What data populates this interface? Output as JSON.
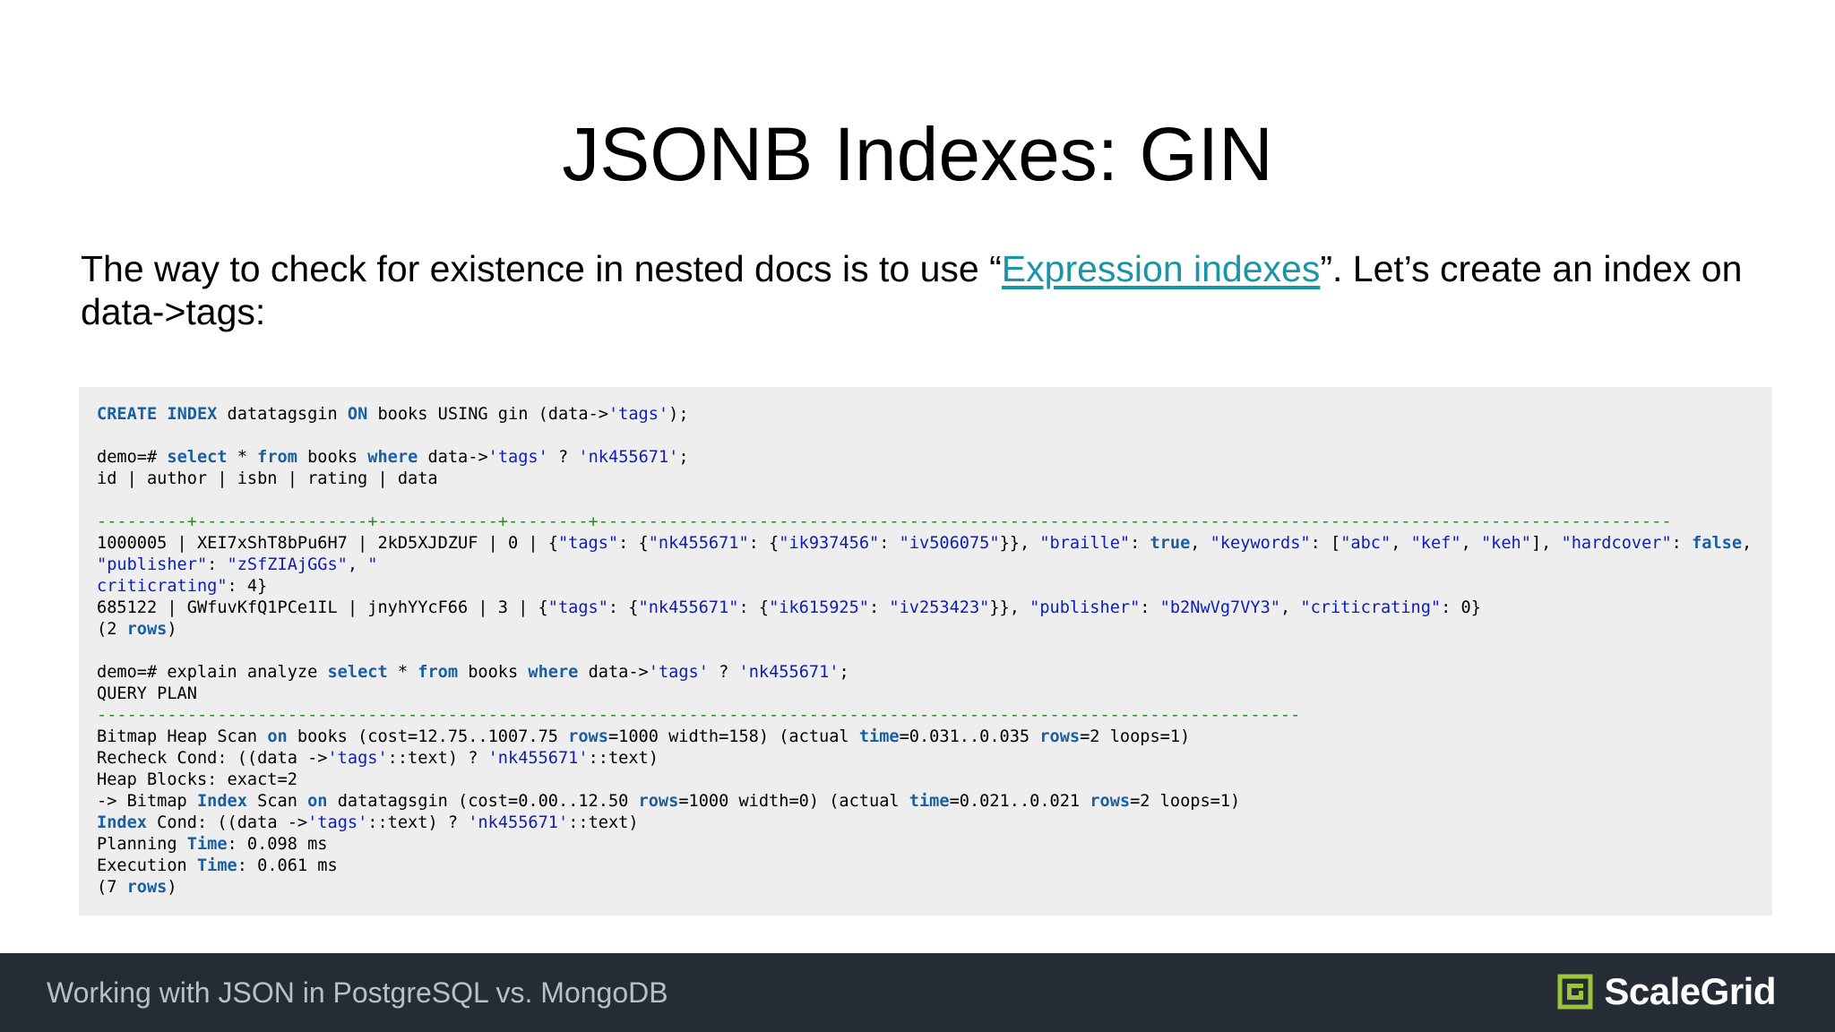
{
  "slide": {
    "title": "JSONB Indexes: GIN",
    "intro_before": "The way to check for existence in nested docs is to use “",
    "intro_link": "Expression indexes",
    "intro_after": "”. Let’s create an index on data->tags:"
  },
  "code": {
    "lines": [
      [
        [
          "CREATE",
          "kw"
        ],
        [
          " ",
          ""
        ],
        [
          "INDEX",
          "kw"
        ],
        [
          " datatagsgin ",
          ""
        ],
        [
          "ON",
          "kw"
        ],
        [
          " books USING gin (data->",
          ""
        ],
        [
          "'tags'",
          "str"
        ],
        [
          ");",
          ""
        ]
      ],
      [],
      [
        [
          "demo=# ",
          ""
        ],
        [
          "select",
          "kw"
        ],
        [
          " * ",
          ""
        ],
        [
          "from",
          "kw"
        ],
        [
          " books ",
          ""
        ],
        [
          "where",
          "kw"
        ],
        [
          " data->",
          ""
        ],
        [
          "'tags'",
          "str"
        ],
        [
          " ? ",
          ""
        ],
        [
          "'nk455671'",
          "str"
        ],
        [
          ";",
          ""
        ]
      ],
      [
        [
          "id | author | isbn | rating | data",
          ""
        ]
      ],
      [],
      [
        [
          "---------+-----------------+------------+--------+-----------------------------------------------------------------------------------------------------------",
          "cmt"
        ]
      ],
      [
        [
          "1000005 | XEI7xShT8bPu6H7 | 2kD5XJDZUF | 0 | {",
          ""
        ],
        [
          "\"tags\"",
          "str"
        ],
        [
          ": {",
          ""
        ],
        [
          "\"nk455671\"",
          "str"
        ],
        [
          ": {",
          ""
        ],
        [
          "\"ik937456\"",
          "str"
        ],
        [
          ": ",
          ""
        ],
        [
          "\"iv506075\"",
          "str"
        ],
        [
          "}}, ",
          ""
        ],
        [
          "\"braille\"",
          "str"
        ],
        [
          ": ",
          ""
        ],
        [
          "true",
          "kw"
        ],
        [
          ", ",
          ""
        ],
        [
          "\"keywords\"",
          "str"
        ],
        [
          ": [",
          ""
        ],
        [
          "\"abc\"",
          "str"
        ],
        [
          ", ",
          ""
        ],
        [
          "\"kef\"",
          "str"
        ],
        [
          ", ",
          ""
        ],
        [
          "\"keh\"",
          "str"
        ],
        [
          "], ",
          ""
        ],
        [
          "\"hardcover\"",
          "str"
        ],
        [
          ": ",
          ""
        ],
        [
          "false",
          "kw"
        ],
        [
          ",",
          ""
        ]
      ],
      [
        [
          "\"publisher\"",
          "str"
        ],
        [
          ": ",
          ""
        ],
        [
          "\"zSfZIAjGGs\"",
          "str"
        ],
        [
          ", ",
          ""
        ],
        [
          "\"",
          "str"
        ]
      ],
      [
        [
          "criticrating\"",
          "str"
        ],
        [
          ": 4}",
          ""
        ]
      ],
      [
        [
          "685122 | GWfuvKfQ1PCe1IL | jnyhYYcF66 | 3 | {",
          ""
        ],
        [
          "\"tags\"",
          "str"
        ],
        [
          ": {",
          ""
        ],
        [
          "\"nk455671\"",
          "str"
        ],
        [
          ": {",
          ""
        ],
        [
          "\"ik615925\"",
          "str"
        ],
        [
          ": ",
          ""
        ],
        [
          "\"iv253423\"",
          "str"
        ],
        [
          "}}, ",
          ""
        ],
        [
          "\"publisher\"",
          "str"
        ],
        [
          ": ",
          ""
        ],
        [
          "\"b2NwVg7VY3\"",
          "str"
        ],
        [
          ", ",
          ""
        ],
        [
          "\"criticrating\"",
          "str"
        ],
        [
          ": 0}",
          ""
        ]
      ],
      [
        [
          "(2 ",
          ""
        ],
        [
          "rows",
          "kw"
        ],
        [
          ")",
          ""
        ]
      ],
      [],
      [
        [
          "demo=# explain analyze ",
          ""
        ],
        [
          "select",
          "kw"
        ],
        [
          " * ",
          ""
        ],
        [
          "from",
          "kw"
        ],
        [
          " books ",
          ""
        ],
        [
          "where",
          "kw"
        ],
        [
          " data->",
          ""
        ],
        [
          "'tags'",
          "str"
        ],
        [
          " ? ",
          ""
        ],
        [
          "'nk455671'",
          "str"
        ],
        [
          ";",
          ""
        ]
      ],
      [
        [
          "QUERY PLAN",
          ""
        ]
      ],
      [
        [
          "------------------------------------------------------------------------------------------------------------------------",
          "cmt"
        ]
      ],
      [
        [
          "Bitmap Heap Scan ",
          ""
        ],
        [
          "on",
          "kw"
        ],
        [
          " books (cost=12.75..1007.75 ",
          ""
        ],
        [
          "rows",
          "kw"
        ],
        [
          "=1000 width=158) (actual ",
          ""
        ],
        [
          "time",
          "kw"
        ],
        [
          "=0.031..0.035 ",
          ""
        ],
        [
          "rows",
          "kw"
        ],
        [
          "=2 loops=1)",
          ""
        ]
      ],
      [
        [
          "Recheck Cond: ((data ->",
          ""
        ],
        [
          "'tags'",
          "str"
        ],
        [
          "::text) ? ",
          ""
        ],
        [
          "'nk455671'",
          "str"
        ],
        [
          "::text)",
          ""
        ]
      ],
      [
        [
          "Heap Blocks: exact=2",
          ""
        ]
      ],
      [
        [
          "-> Bitmap ",
          ""
        ],
        [
          "Index",
          "kw"
        ],
        [
          " Scan ",
          ""
        ],
        [
          "on",
          "kw"
        ],
        [
          " datatagsgin (cost=0.00..12.50 ",
          ""
        ],
        [
          "rows",
          "kw"
        ],
        [
          "=1000 width=0) (actual ",
          ""
        ],
        [
          "time",
          "kw"
        ],
        [
          "=0.021..0.021 ",
          ""
        ],
        [
          "rows",
          "kw"
        ],
        [
          "=2 loops=1)",
          ""
        ]
      ],
      [
        [
          "Index",
          "kw"
        ],
        [
          " Cond: ((data ->",
          ""
        ],
        [
          "'tags'",
          "str"
        ],
        [
          "::text) ? ",
          ""
        ],
        [
          "'nk455671'",
          "str"
        ],
        [
          "::text)",
          ""
        ]
      ],
      [
        [
          "Planning ",
          ""
        ],
        [
          "Time",
          "kw"
        ],
        [
          ": 0.098 ms",
          ""
        ]
      ],
      [
        [
          "Execution ",
          ""
        ],
        [
          "Time",
          "kw"
        ],
        [
          ": 0.061 ms",
          ""
        ]
      ],
      [
        [
          "(7 ",
          ""
        ],
        [
          "rows",
          "kw"
        ],
        [
          ")",
          ""
        ]
      ]
    ]
  },
  "footer": {
    "text": "Working with JSON in PostgreSQL vs. MongoDB",
    "logo_text": "ScaleGrid",
    "logo_accent_color": "#9bc53d"
  },
  "colors": {
    "background": "#ffffff",
    "code_background": "#eeeeee",
    "footer_background": "#252c35",
    "link": "#1a95a8",
    "keyword": "#1a5fa0",
    "string": "#0d1fb5",
    "separator": "#2a8a2a"
  }
}
